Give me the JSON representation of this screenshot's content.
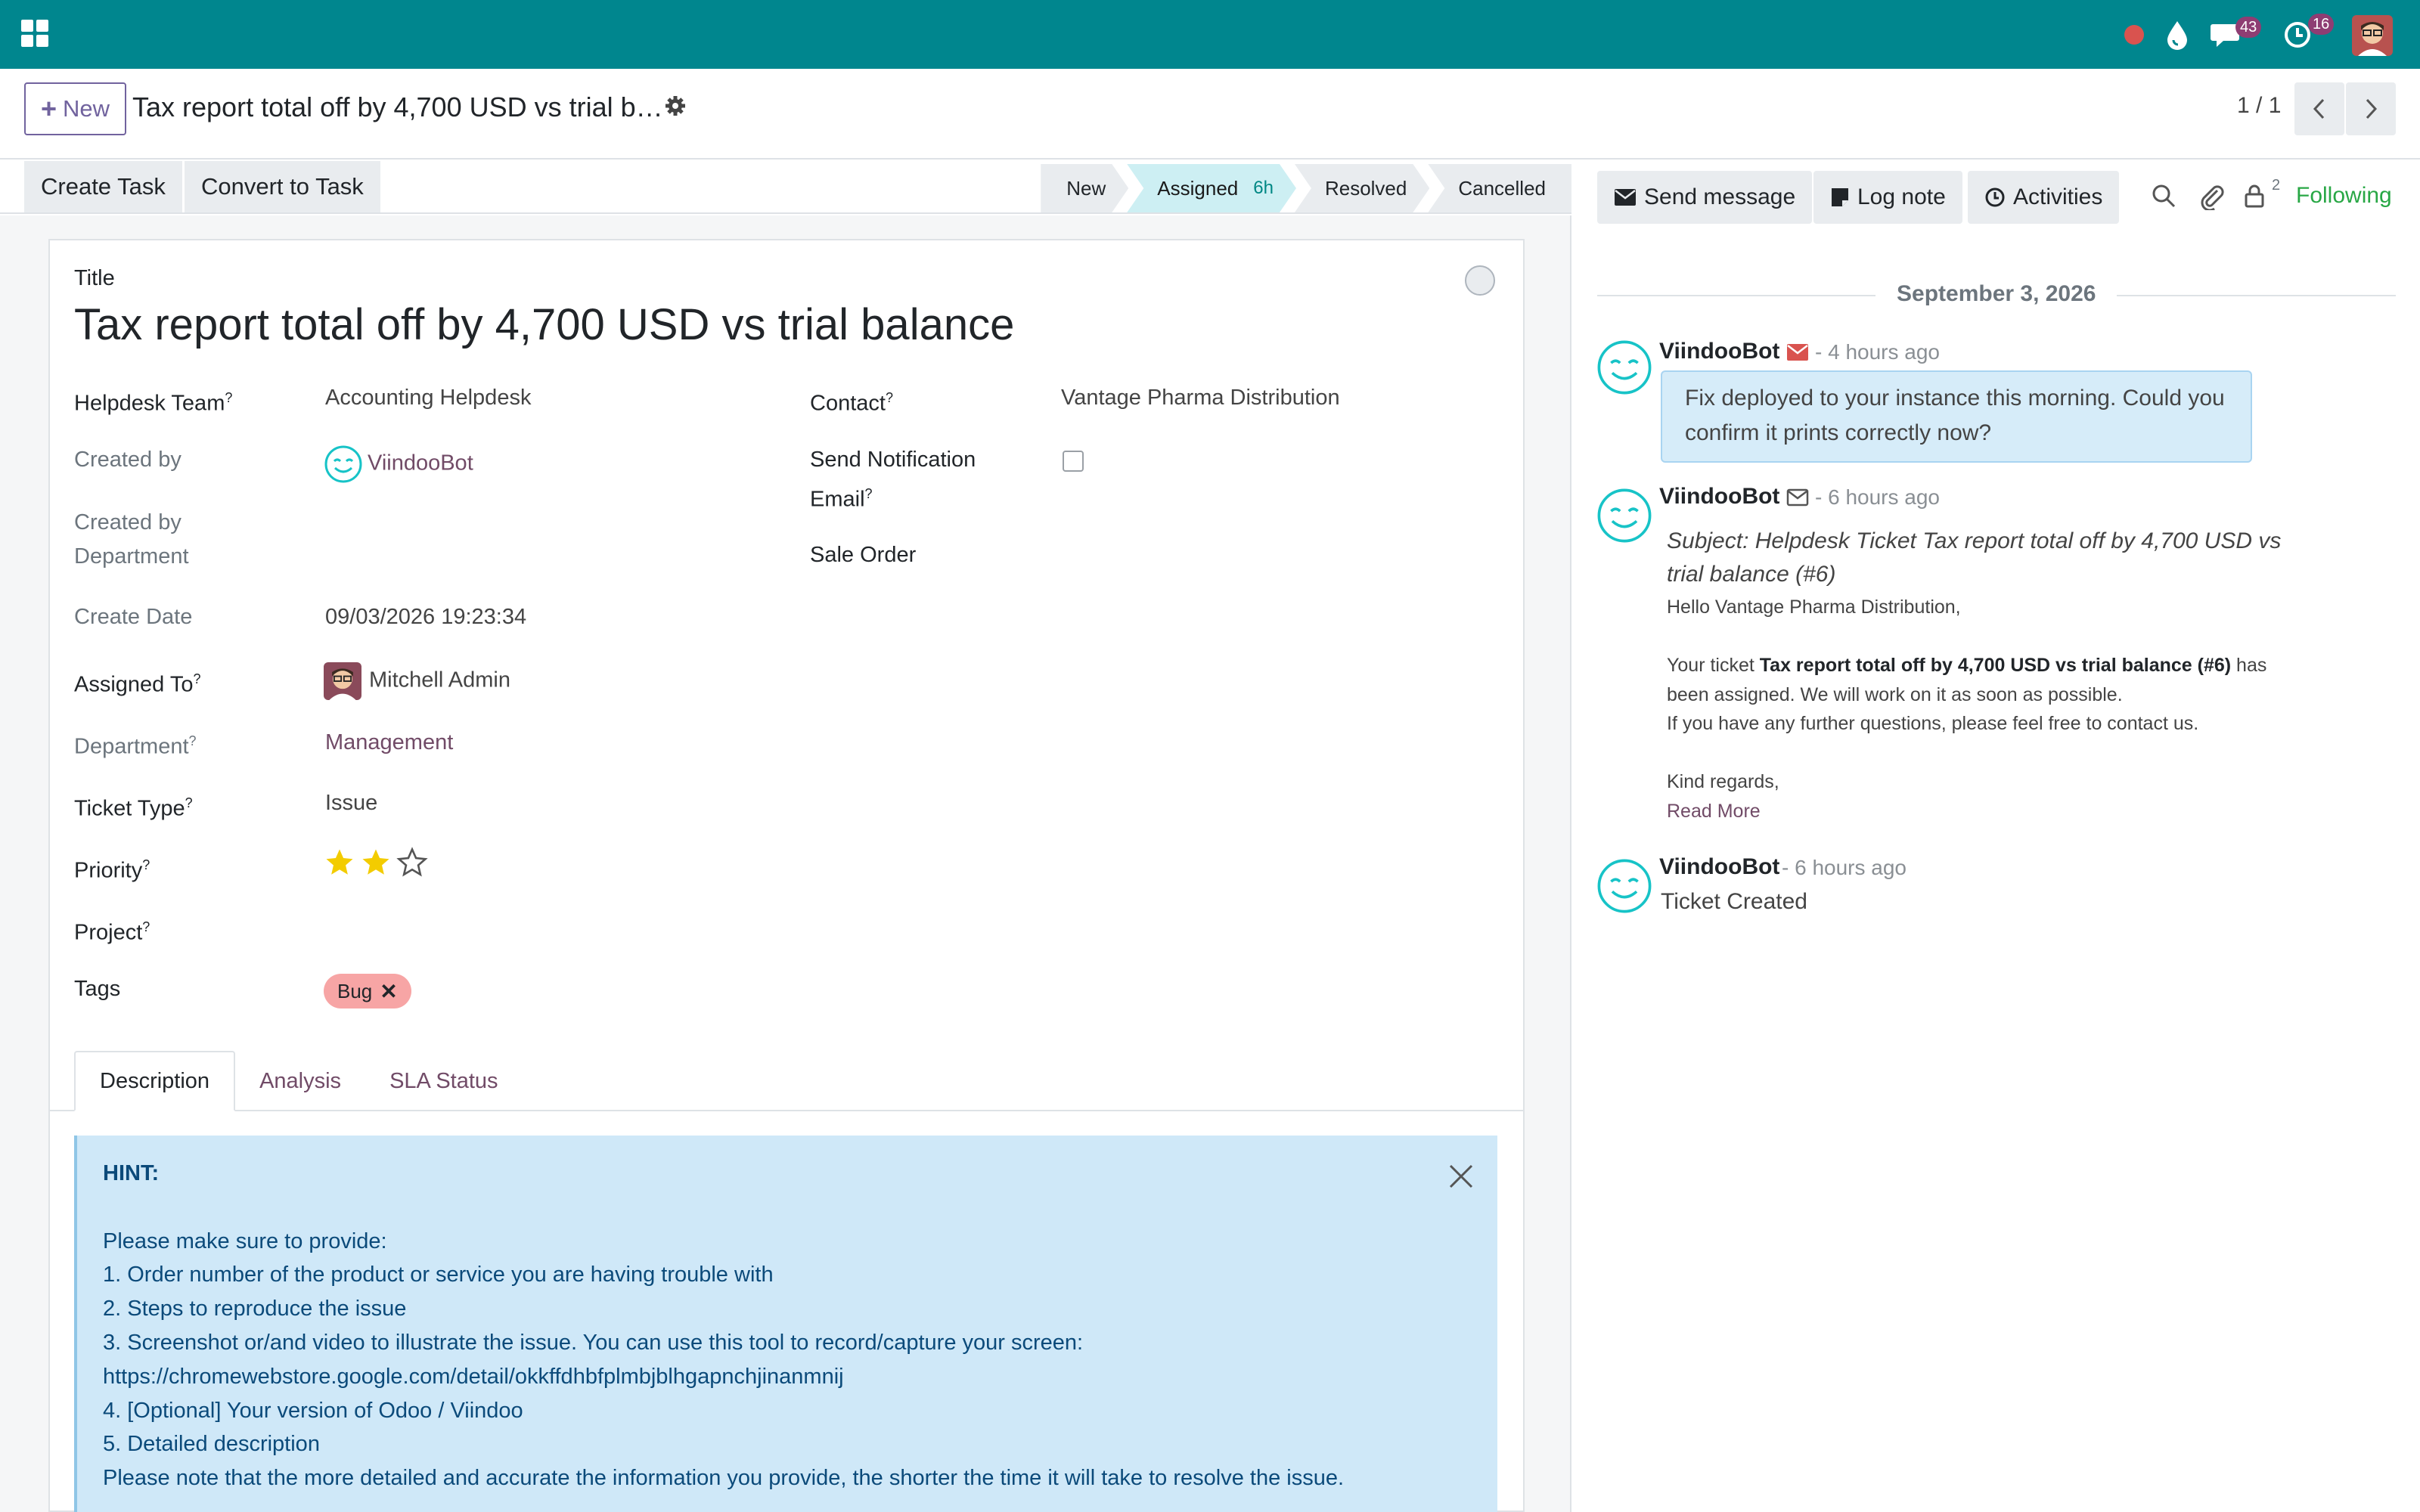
{
  "navbar": {
    "chat_count": "43",
    "activity_count": "16"
  },
  "control": {
    "new_label": "New",
    "record_title": "Tax report total off by 4,700 USD vs trial b…",
    "pager": "1 / 1"
  },
  "actions": {
    "create_task": "Create Task",
    "convert_task": "Convert to Task"
  },
  "stages": [
    {
      "label": "New",
      "duration": ""
    },
    {
      "label": "Assigned",
      "duration": "6h"
    },
    {
      "label": "Resolved",
      "duration": ""
    },
    {
      "label": "Cancelled",
      "duration": ""
    }
  ],
  "form": {
    "title_label": "Title",
    "title": "Tax report total off by 4,700 USD vs trial balance",
    "helpdesk_team_label": "Helpdesk Team",
    "helpdesk_team": "Accounting Helpdesk",
    "contact_label": "Contact",
    "contact": "Vantage Pharma Distribution",
    "created_by_label": "Created by",
    "created_by": "ViindooBot",
    "send_notification_label_1": "Send Notification",
    "send_notification_label_2": "Email",
    "created_by_dept_label_1": "Created by",
    "created_by_dept_label_2": "Department",
    "sale_order_label": "Sale Order",
    "create_date_label": "Create Date",
    "create_date": "09/03/2026 19:23:34",
    "assigned_to_label": "Assigned To",
    "assigned_to": "Mitchell Admin",
    "department_label": "Department",
    "department": "Management",
    "ticket_type_label": "Ticket Type",
    "ticket_type": "Issue",
    "priority_label": "Priority",
    "priority_rating": 2,
    "priority_max": 3,
    "project_label": "Project",
    "tags_label": "Tags",
    "tag": "Bug",
    "help_mark": "?"
  },
  "tabs": {
    "description": "Description",
    "analysis": "Analysis",
    "sla": "SLA Status"
  },
  "hint": {
    "title": "HINT:",
    "intro": "Please make sure to provide:",
    "line1": "1. Order number of the product or service you are having trouble with",
    "line2": "2. Steps to reproduce the issue",
    "line3": "3. Screenshot or/and video to illustrate the issue. You can use this tool to record/capture your screen:",
    "line3_url": "https://chromewebstore.google.com/detail/okkffdhbfplmbjblhgapnchjinanmnij",
    "line4": "4. [Optional] Your version of Odoo / Viindoo",
    "line5": "5. Detailed description",
    "outro": "Please note that the more detailed and accurate the information you provide, the shorter the time it will take to resolve the issue."
  },
  "chatter": {
    "send_message": "Send message",
    "log_note": "Log note",
    "activities": "Activities",
    "followers_count": "2",
    "following": "Following",
    "date": "September 3, 2026",
    "messages": [
      {
        "author": "ViindooBot",
        "time": "- 4 hours ago",
        "body_1": "Fix deployed to your instance this morning. Could you",
        "body_2": "confirm it prints correctly now?"
      },
      {
        "author": "ViindooBot",
        "time": "- 6 hours ago",
        "subject_1": "Subject: Helpdesk Ticket Tax report total off by 4,700 USD vs",
        "subject_2": "trial balance (#6)",
        "greeting": "Hello Vantage Pharma Distribution,",
        "ticket_prefix": "Your ticket ",
        "ticket_name": "Tax report total off by 4,700 USD vs trial balance (#6)",
        "ticket_suffix": " has",
        "assigned_line": "been assigned. We will work on it as soon as possible.",
        "questions_line": "If you have any further questions, please feel free to contact us.",
        "regards": "Kind regards,",
        "read_more": "Read More"
      },
      {
        "author": "ViindooBot",
        "time": "- 6 hours ago",
        "body": "Ticket Created"
      }
    ]
  },
  "colors": {
    "navbar": "#00868e",
    "brand": "#714b67",
    "following": "#28a745",
    "hint_bg": "#cfe8f8",
    "tag_bg": "#f7a5a5",
    "star": "#f3cc00"
  }
}
